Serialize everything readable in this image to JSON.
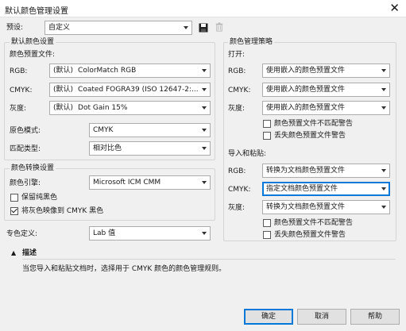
{
  "window": {
    "title": "默认颜色管理设置",
    "close_glyph": "✕"
  },
  "preset": {
    "label": "预设:",
    "value": "自定义"
  },
  "default_colors": {
    "title": "默认颜色设置",
    "profiles_label": "颜色预置文件:",
    "rgb": {
      "label": "RGB:",
      "tag": "(默认)",
      "value": "ColorMatch RGB"
    },
    "cmyk": {
      "label": "CMYK:",
      "tag": "(默认)",
      "value": "Coated FOGRA39 (ISO 12647-2:..."
    },
    "gray": {
      "label": "灰度:",
      "tag": "(默认)",
      "value": "Dot Gain 15%"
    },
    "primary_mode": {
      "label": "原色模式:",
      "value": "CMYK"
    },
    "rendering_intent": {
      "label": "匹配类型:",
      "value": "相对比色"
    }
  },
  "conversion": {
    "title": "颜色转换设置",
    "engine": {
      "label": "颜色引擎:",
      "value": "Microsoft ICM CMM"
    },
    "preserve_black": {
      "label": "保留纯黑色",
      "checked": false
    },
    "map_gray": {
      "label": "将灰色映像到 CMYK 黑色",
      "checked": true
    }
  },
  "spot": {
    "label": "专色定义:",
    "value": "Lab 值"
  },
  "policies": {
    "title": "颜色管理策略",
    "open": {
      "title": "打开:",
      "rgb": {
        "label": "RGB:",
        "value": "使用嵌入的颜色预置文件"
      },
      "cmyk": {
        "label": "CMYK:",
        "value": "使用嵌入的颜色预置文件"
      },
      "gray": {
        "label": "灰度:",
        "value": "使用嵌入的颜色预置文件"
      },
      "warn_mismatch": {
        "label": "颜色预置文件不匹配警告",
        "checked": false
      },
      "warn_missing": {
        "label": "丢失颜色预置文件警告",
        "checked": false
      }
    },
    "import_paste": {
      "title": "导入和粘贴:",
      "rgb": {
        "label": "RGB:",
        "value": "转换为文档颜色预置文件"
      },
      "cmyk": {
        "label": "CMYK:",
        "value": "指定文档颜色预置文件"
      },
      "gray": {
        "label": "灰度:",
        "value": "转换为文档颜色预置文件"
      },
      "warn_mismatch": {
        "label": "颜色预置文件不匹配警告",
        "checked": false
      },
      "warn_missing": {
        "label": "丢失颜色预置文件警告",
        "checked": false
      }
    }
  },
  "description": {
    "toggle_glyph": "▲",
    "title": "描述",
    "text": "当您导入和粘贴文档时，选择用于 CMYK 颜色的颜色管理规则。"
  },
  "buttons": {
    "ok": "确定",
    "cancel": "取消",
    "help": "帮助"
  },
  "colors": {
    "accent": "#0078d7",
    "background": "#f0f0f0"
  }
}
